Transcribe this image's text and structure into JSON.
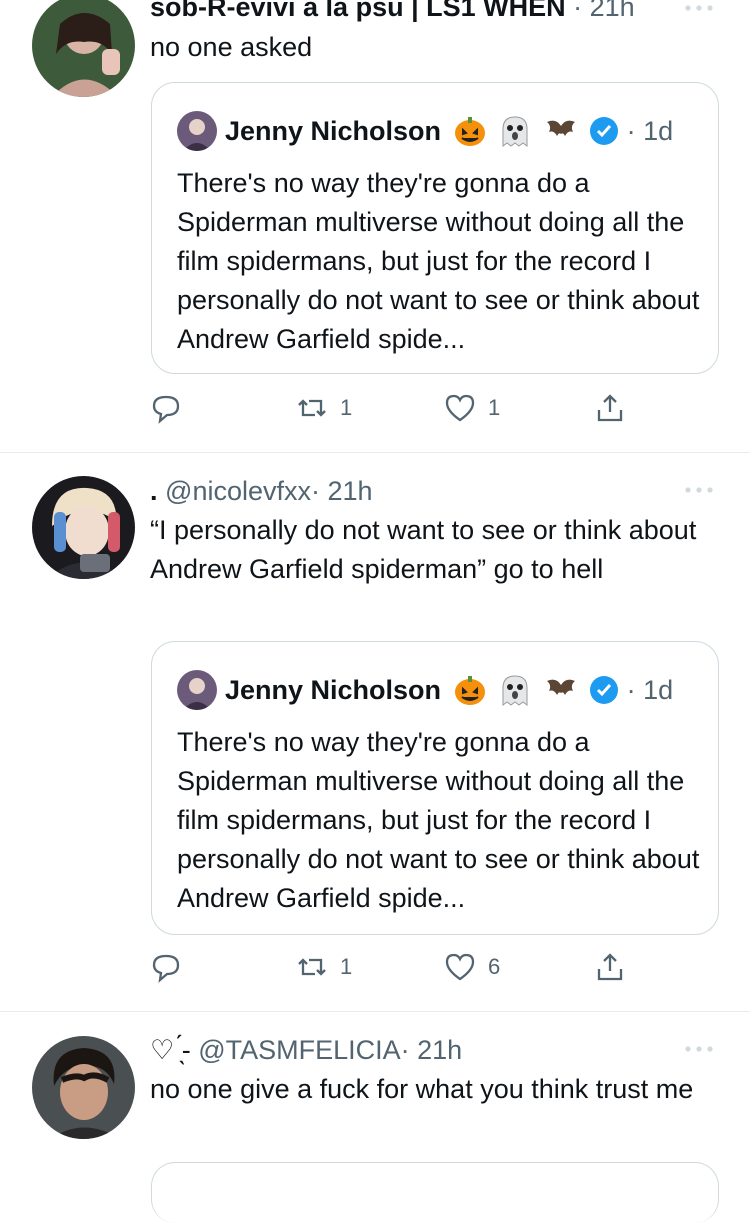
{
  "tweets": [
    {
      "display_name": "sob-R-evivi a la psu | LS1 WHEN",
      "handle": "",
      "time": "· 21h",
      "text": "no one asked",
      "quote": {
        "name": "Jenny Nicholson",
        "emoji": [
          "pumpkin-emoji",
          "ghost-emoji",
          "bat-emoji"
        ],
        "time": "· 1d",
        "text": "There's no way they're gonna do a Spiderman multiverse without doing all the film spidermans, but just for the record I personally do not want to see or think about Andrew Garfield spide..."
      },
      "actions": {
        "replies": "",
        "retweets": "1",
        "likes": "1"
      }
    },
    {
      "display_name": ".",
      "handle": "@nicolevfxx",
      "time": "· 21h",
      "text": "“I personally do not want to see or think about Andrew Garfield spiderman” go to hell",
      "quote": {
        "name": "Jenny Nicholson",
        "emoji": [
          "pumpkin-emoji",
          "ghost-emoji",
          "bat-emoji"
        ],
        "time": "· 1d",
        "text": "There's no way they're gonna do a Spiderman multiverse without doing all the film spidermans, but just for the record I personally do not want to see or think about Andrew Garfield spide..."
      },
      "actions": {
        "replies": "",
        "retweets": "1",
        "likes": "6"
      }
    },
    {
      "display_name": "♡ ̖́-",
      "handle": "@TASMFELICIA",
      "time": "· 21h",
      "text": "no one give a fuck for what you think trust me"
    }
  ],
  "colors": {
    "text": "#0f1419",
    "muted": "#536471",
    "border": "#cfd9de",
    "verified": "#1d9bf0",
    "divider": "#e6ecf0"
  }
}
